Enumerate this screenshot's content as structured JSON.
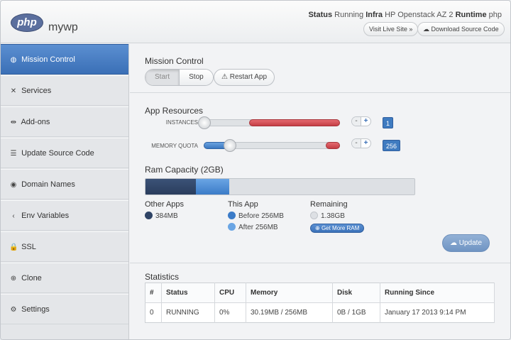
{
  "header": {
    "logo_text": "php",
    "app_name": "mywp",
    "status_label": "Status",
    "status_value": "Running",
    "infra_label": "Infra",
    "infra_value": "HP Openstack AZ 2",
    "runtime_label": "Runtime",
    "runtime_value": "php",
    "visit_live_site": "Visit Live Site »",
    "download_source": "Download Source Code"
  },
  "sidebar": {
    "items": [
      {
        "label": "Mission Control",
        "icon": "gauge-icon",
        "glyph": "◍",
        "active": true
      },
      {
        "label": "Services",
        "icon": "wrench-icon",
        "glyph": "✕"
      },
      {
        "label": "Add-ons",
        "icon": "plug-icon",
        "glyph": "⇹"
      },
      {
        "label": "Update Source Code",
        "icon": "list-icon",
        "glyph": "☰"
      },
      {
        "label": "Domain Names",
        "icon": "globe-icon",
        "glyph": "◉"
      },
      {
        "label": "Env Variables",
        "icon": "share-icon",
        "glyph": "‹"
      },
      {
        "label": "SSL",
        "icon": "lock-icon",
        "glyph": "🔒"
      },
      {
        "label": "Clone",
        "icon": "plus-circle-icon",
        "glyph": "⊕"
      },
      {
        "label": "Settings",
        "icon": "gear-icon",
        "glyph": "⚙"
      }
    ]
  },
  "mission": {
    "title": "Mission Control",
    "start": "Start",
    "stop": "Stop",
    "restart": "Restart App"
  },
  "resources": {
    "title": "App Resources",
    "instances_label": "INSTANCES",
    "instances_value": "1",
    "memory_label": "MEMORY QUOTA",
    "memory_value": "256",
    "minus": "-",
    "plus": "+"
  },
  "ram": {
    "title": "Ram Capacity (2GB)",
    "other_fraction": 0.1875,
    "this_fraction": 0.125,
    "other_apps_title": "Other Apps",
    "other_apps_value": "384MB",
    "this_app_title": "This App",
    "before": "Before 256MB",
    "after": "After 256MB",
    "remaining_title": "Remaining",
    "remaining_value": "1.38GB",
    "get_more_ram": "Get More RAM",
    "update": "Update",
    "colors": {
      "other": "#2f4466",
      "this_before": "#3b7bc8",
      "this_after": "#6aa5e4",
      "remaining": "#dde0e4"
    }
  },
  "statistics": {
    "title": "Statistics",
    "columns": [
      "#",
      "Status",
      "CPU",
      "Memory",
      "Disk",
      "Running Since"
    ],
    "rows": [
      [
        "0",
        "RUNNING",
        "0%",
        "30.19MB / 256MB",
        "0B / 1GB",
        "January 17 2013 9:14 PM"
      ]
    ]
  }
}
